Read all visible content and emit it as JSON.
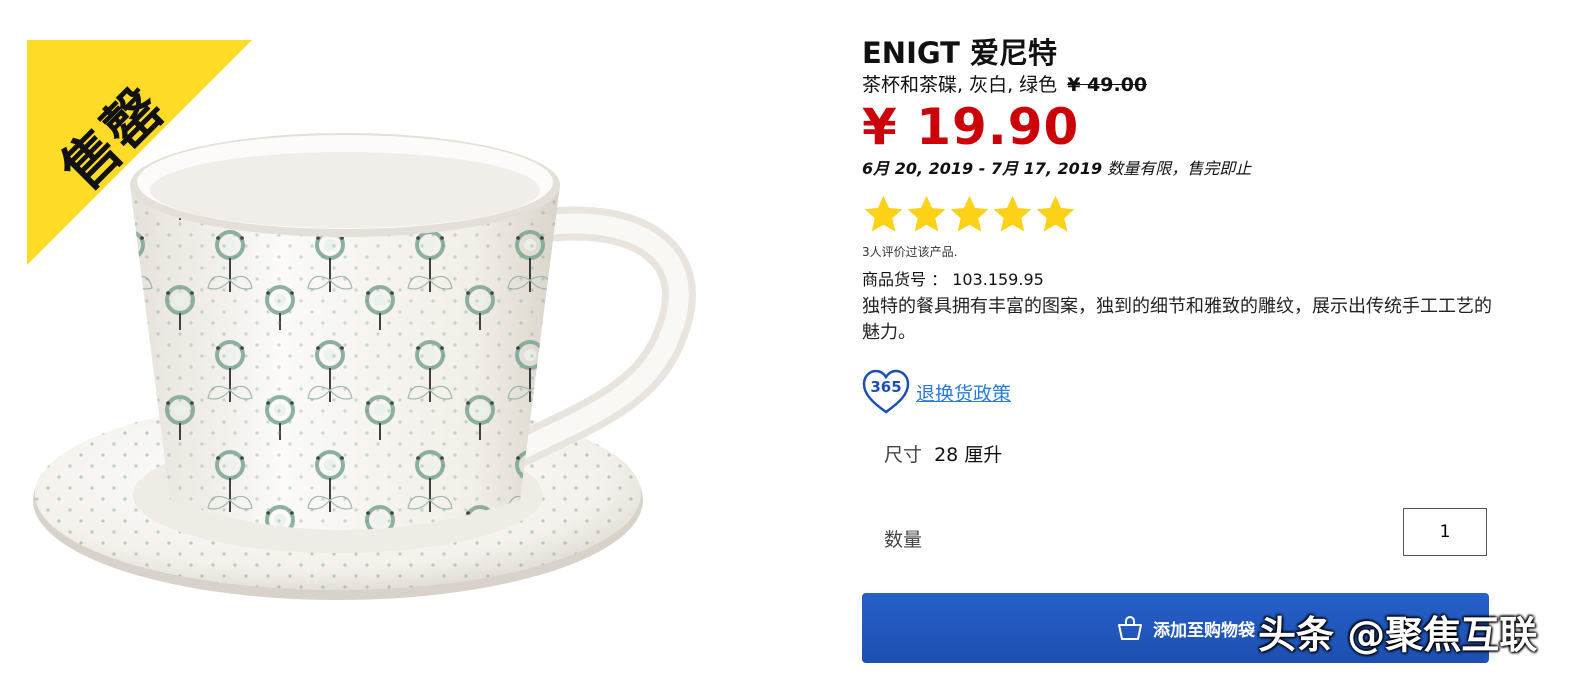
{
  "image": {
    "sale_badge": "售罄"
  },
  "product": {
    "name": "ENIGT 爱尼特",
    "subtitle": "茶杯和茶碟, 灰白, 绿色",
    "old_price": "¥ 49.00",
    "price": "¥ 19.90",
    "date_range": "6月 20, 2019 - 7月 17, 2019",
    "availability_note": "数量有限，售完即止",
    "rating": 5,
    "rating_max": 5,
    "review_count_text": "3人评价过该产品.",
    "article_label": "商品货号 ：",
    "article_number": "103.159.95",
    "description": "独特的餐具拥有丰富的图案，独到的细节和雅致的雕纹，展示出传统手工工艺的魅力。"
  },
  "return_policy": {
    "badge_number": "365",
    "link_label": "退换货政策"
  },
  "size": {
    "label": "尺寸",
    "value": "28 厘升"
  },
  "quantity": {
    "label": "数量",
    "value": "1"
  },
  "cart": {
    "button_label": "添加至购物袋",
    "icon": "shopping-bag-icon"
  },
  "watermark": "头条 @聚焦互联",
  "colors": {
    "price_red": "#cc0008",
    "sale_yellow": "#fddb26",
    "button_blue": "#2660c9",
    "link_blue": "#2a7bd8",
    "star_yellow": "#fcd116",
    "pattern_green": "#6e9a86"
  }
}
